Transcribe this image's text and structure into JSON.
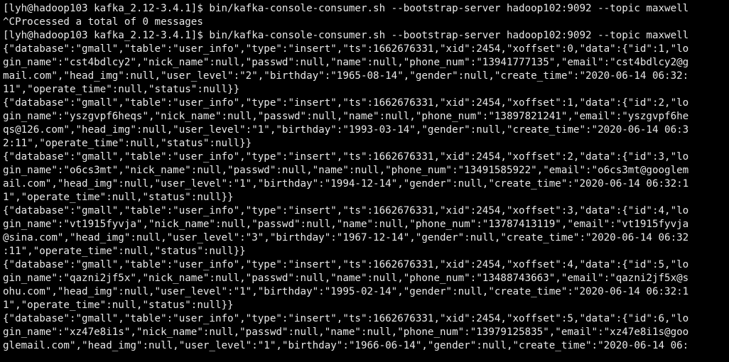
{
  "terminal": {
    "lines": [
      "[lyh@hadoop103 kafka_2.12-3.4.1]$ bin/kafka-console-consumer.sh --bootstrap-server hadoop102:9092 --topic maxwell",
      "^CProcessed a total of 0 messages",
      "[lyh@hadoop103 kafka_2.12-3.4.1]$ bin/kafka-console-consumer.sh --bootstrap-server hadoop102:9092 --topic maxwell",
      "{\"database\":\"gmall\",\"table\":\"user_info\",\"type\":\"insert\",\"ts\":1662676331,\"xid\":2454,\"xoffset\":0,\"data\":{\"id\":1,\"lo",
      "gin_name\":\"cst4bdlcy2\",\"nick_name\":null,\"passwd\":null,\"name\":null,\"phone_num\":\"13941777135\",\"email\":\"cst4bdlcy2@g",
      "mail.com\",\"head_img\":null,\"user_level\":\"2\",\"birthday\":\"1965-08-14\",\"gender\":null,\"create_time\":\"2020-06-14 06:32:",
      "11\",\"operate_time\":null,\"status\":null}}",
      "{\"database\":\"gmall\",\"table\":\"user_info\",\"type\":\"insert\",\"ts\":1662676331,\"xid\":2454,\"xoffset\":1,\"data\":{\"id\":2,\"lo",
      "gin_name\":\"yszgvpf6heqs\",\"nick_name\":null,\"passwd\":null,\"name\":null,\"phone_num\":\"13897821241\",\"email\":\"yszgvpf6he",
      "qs@126.com\",\"head_img\":null,\"user_level\":\"1\",\"birthday\":\"1993-03-14\",\"gender\":null,\"create_time\":\"2020-06-14 06:3",
      "2:11\",\"operate_time\":null,\"status\":null}}",
      "{\"database\":\"gmall\",\"table\":\"user_info\",\"type\":\"insert\",\"ts\":1662676331,\"xid\":2454,\"xoffset\":2,\"data\":{\"id\":3,\"lo",
      "gin_name\":\"o6cs3mt\",\"nick_name\":null,\"passwd\":null,\"name\":null,\"phone_num\":\"13491585922\",\"email\":\"o6cs3mt@googlem",
      "ail.com\",\"head_img\":null,\"user_level\":\"1\",\"birthday\":\"1994-12-14\",\"gender\":null,\"create_time\":\"2020-06-14 06:32:1",
      "1\",\"operate_time\":null,\"status\":null}}",
      "{\"database\":\"gmall\",\"table\":\"user_info\",\"type\":\"insert\",\"ts\":1662676331,\"xid\":2454,\"xoffset\":3,\"data\":{\"id\":4,\"lo",
      "gin_name\":\"vt1915fyvja\",\"nick_name\":null,\"passwd\":null,\"name\":null,\"phone_num\":\"13787413119\",\"email\":\"vt1915fyvja",
      "@sina.com\",\"head_img\":null,\"user_level\":\"3\",\"birthday\":\"1967-12-14\",\"gender\":null,\"create_time\":\"2020-06-14 06:32",
      ":11\",\"operate_time\":null,\"status\":null}}",
      "{\"database\":\"gmall\",\"table\":\"user_info\",\"type\":\"insert\",\"ts\":1662676331,\"xid\":2454,\"xoffset\":4,\"data\":{\"id\":5,\"lo",
      "gin_name\":\"qazni2jf5x\",\"nick_name\":null,\"passwd\":null,\"name\":null,\"phone_num\":\"13488743663\",\"email\":\"qazni2jf5x@s",
      "ohu.com\",\"head_img\":null,\"user_level\":\"1\",\"birthday\":\"1995-02-14\",\"gender\":null,\"create_time\":\"2020-06-14 06:32:1",
      "1\",\"operate_time\":null,\"status\":null}}",
      "{\"database\":\"gmall\",\"table\":\"user_info\",\"type\":\"insert\",\"ts\":1662676331,\"xid\":2454,\"xoffset\":5,\"data\":{\"id\":6,\"lo",
      "gin_name\":\"xz47e8i1s\",\"nick_name\":null,\"passwd\":null,\"name\":null,\"phone_num\":\"13979125835\",\"email\":\"xz47e8i1s@goo",
      "glemail.com\",\"head_img\":null,\"user_level\":\"1\",\"birthday\":\"1966-06-14\",\"gender\":null,\"create_time\":\"2020-06-14 06:"
    ]
  },
  "colors": {
    "background": "#000000",
    "foreground": "#e8e8e8"
  }
}
